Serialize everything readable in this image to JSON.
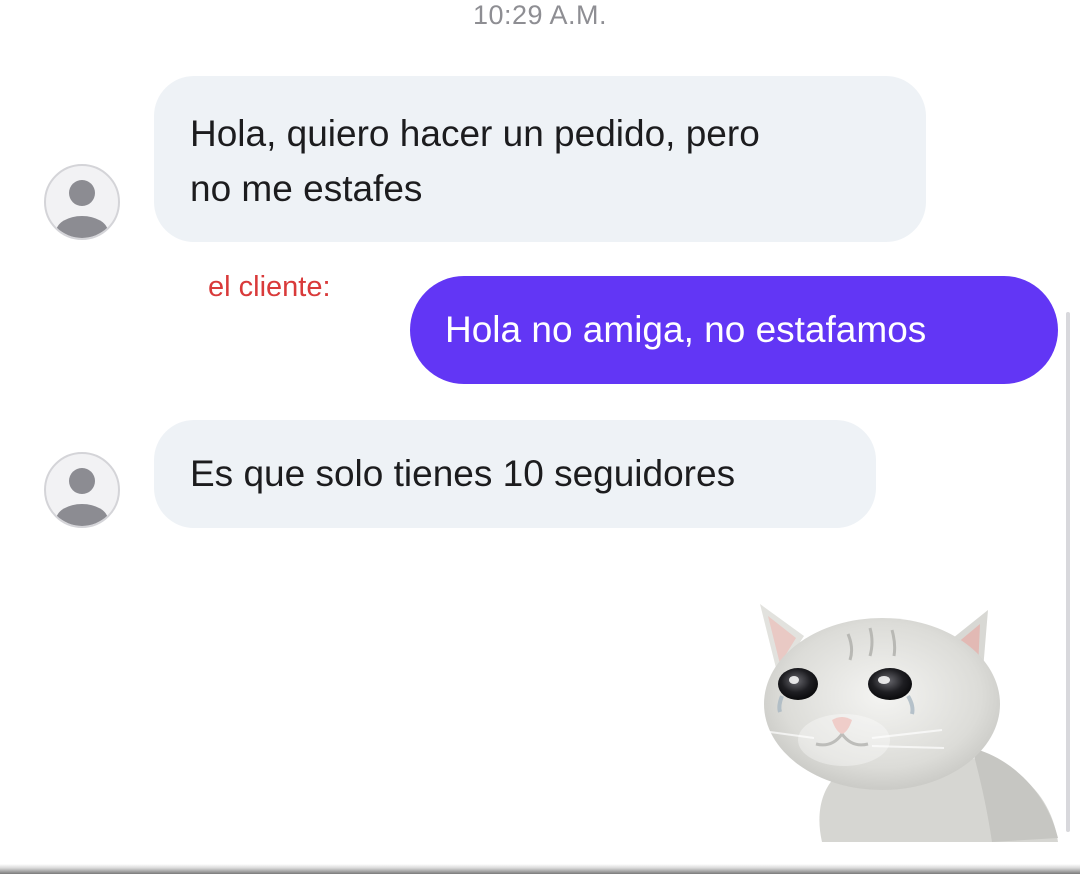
{
  "status": {
    "time": "10:29 A.M."
  },
  "messages": [
    {
      "direction": "incoming",
      "lines": [
        "Hola, quiero hacer un pedido, pero",
        "no me estafes"
      ]
    },
    {
      "direction": "outgoing",
      "annotation": "el cliente:",
      "lines": [
        "Hola no amiga, no estafamos"
      ]
    },
    {
      "direction": "incoming",
      "lines": [
        "Es que solo tienes 10 seguidores"
      ]
    }
  ],
  "sticker": {
    "icon": "crying-cat-sticker"
  },
  "colors": {
    "incoming_bubble": "#eef2f6",
    "outgoing_bubble": "#6236f5",
    "annotation": "#d93a3a",
    "timestamp": "#8e8e93"
  }
}
